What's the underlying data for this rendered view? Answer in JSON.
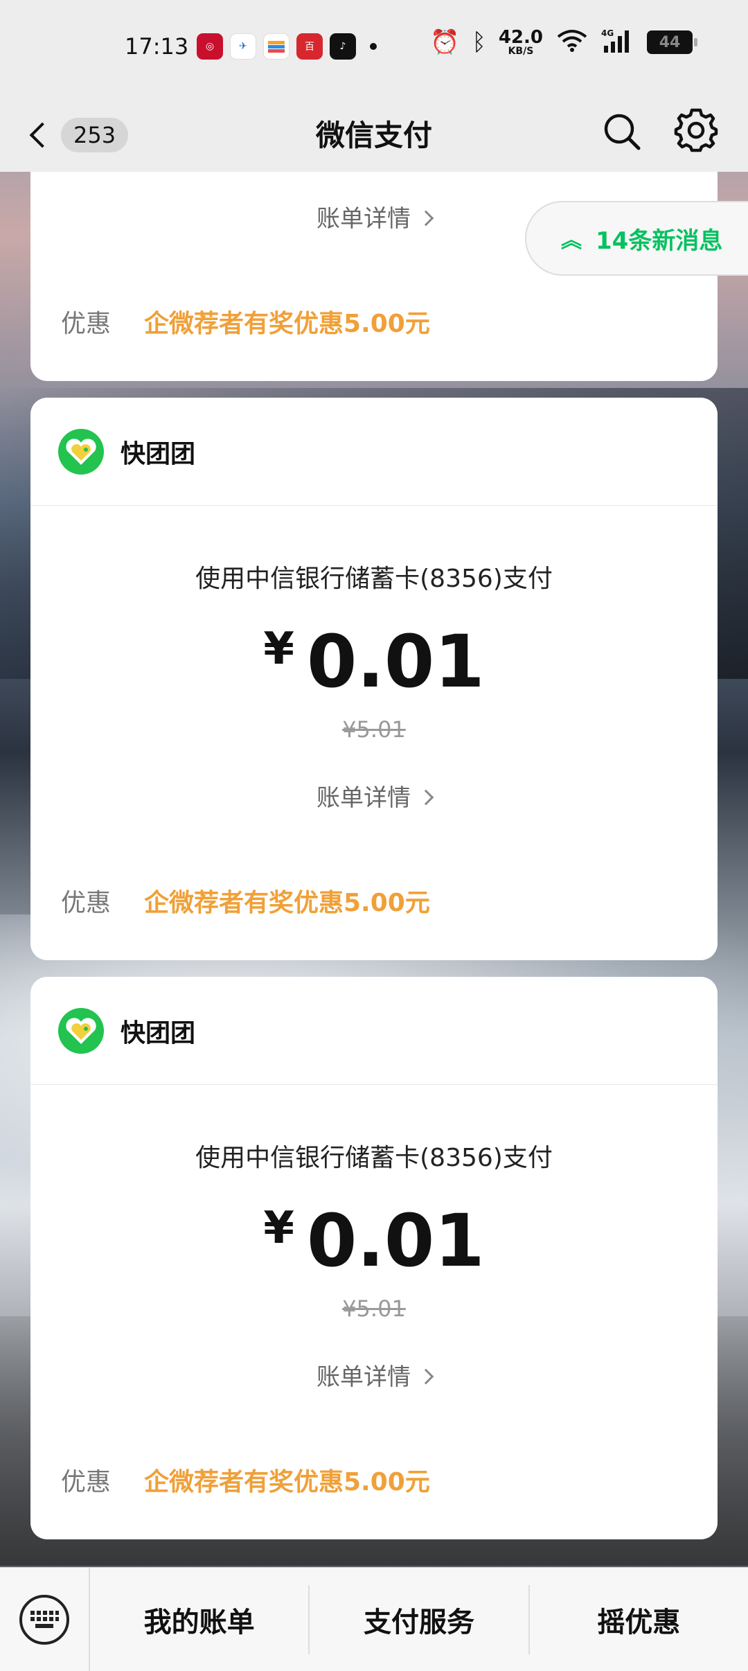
{
  "status_bar": {
    "time": "17:13",
    "net_speed_value": "42.0",
    "net_speed_unit": "KB/S",
    "battery": "44",
    "app_icons": [
      "bank-icon",
      "telecom-icon",
      "wallet-icon",
      "baidu-icon",
      "tiktok-icon"
    ]
  },
  "nav": {
    "back_count": "253",
    "title": "微信支付"
  },
  "new_messages": {
    "label": "14条新消息"
  },
  "cards": [
    {
      "detail_label": "账单详情",
      "discount_label": "优惠",
      "discount_value": "企微荐者有奖优惠5.00元"
    },
    {
      "merchant": "快团团",
      "pay_method": "使用中信银行储蓄卡(8356)支付",
      "currency": "¥",
      "amount": "0.01",
      "original": "¥5.01",
      "detail_label": "账单详情",
      "discount_label": "优惠",
      "discount_value": "企微荐者有奖优惠5.00元"
    },
    {
      "merchant": "快团团",
      "pay_method": "使用中信银行储蓄卡(8356)支付",
      "currency": "¥",
      "amount": "0.01",
      "original": "¥5.01",
      "detail_label": "账单详情",
      "discount_label": "优惠",
      "discount_value": "企微荐者有奖优惠5.00元"
    }
  ],
  "bottom_menu": [
    "我的账单",
    "支付服务",
    "摇优惠"
  ],
  "colors": {
    "wechat_green": "#07c160",
    "discount_orange": "#f0a038",
    "merchant_logo_green": "#22c34e"
  }
}
